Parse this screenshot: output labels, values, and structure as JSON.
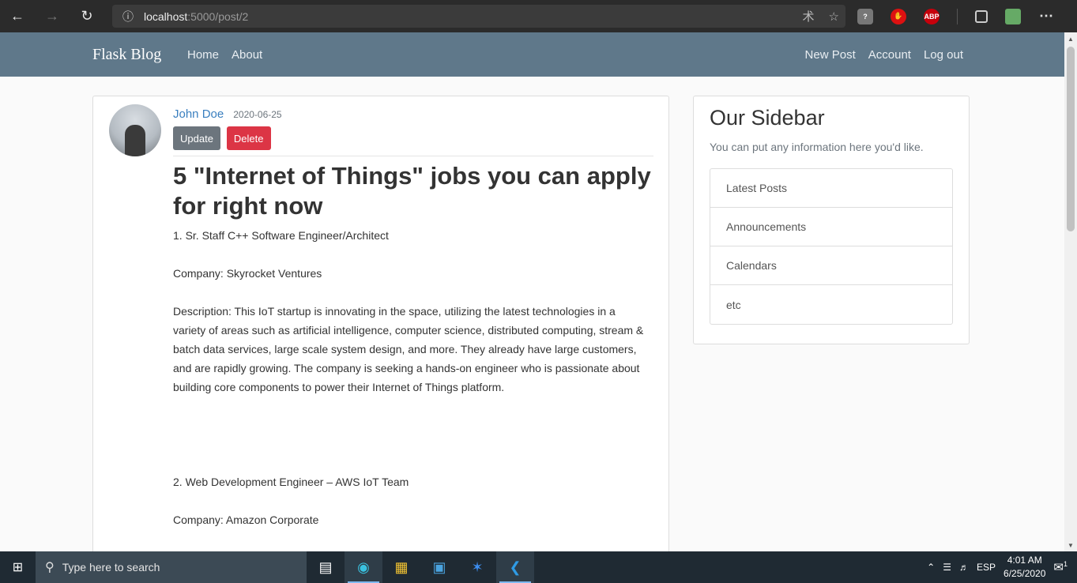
{
  "browser": {
    "url_host": "localhost",
    "url_rest": ":5000/post/2"
  },
  "navbar": {
    "brand": "Flask Blog",
    "left_links": [
      "Home",
      "About"
    ],
    "right_links": [
      "New Post",
      "Account",
      "Log out"
    ]
  },
  "post": {
    "author": "John Doe",
    "date": "2020-06-25",
    "update_label": "Update",
    "delete_label": "Delete",
    "title": "5 \"Internet of Things\" jobs you can apply for right now",
    "paragraphs": [
      "1. Sr. Staff C++ Software Engineer/Architect",
      "Company: Skyrocket Ventures",
      "Description: This IoT startup is innovating in the space, utilizing the latest technologies in a variety of areas such as artificial intelligence, computer science, distributed computing, stream & batch data services, large scale system design, and more. They already have large customers, and are rapidly growing. The company is seeking a hands-on engineer who is passionate about building core components to power their Internet of Things platform.",
      "",
      "2. Web Development Engineer – AWS IoT Team",
      "Company: Amazon Corporate"
    ]
  },
  "sidebar": {
    "title": "Our Sidebar",
    "subtitle": "You can put any information here you'd like.",
    "items": [
      "Latest Posts",
      "Announcements",
      "Calendars",
      "etc"
    ]
  },
  "taskbar": {
    "search_placeholder": "Type here to search",
    "language": "ESP",
    "time": "4:01 AM",
    "date": "6/25/2020",
    "notification_count": "1"
  },
  "colors": {
    "navbar_bg": "#5f788a",
    "delete_btn": "#dc3545",
    "update_btn": "#6c757d",
    "author_link": "#3a7fbf"
  }
}
